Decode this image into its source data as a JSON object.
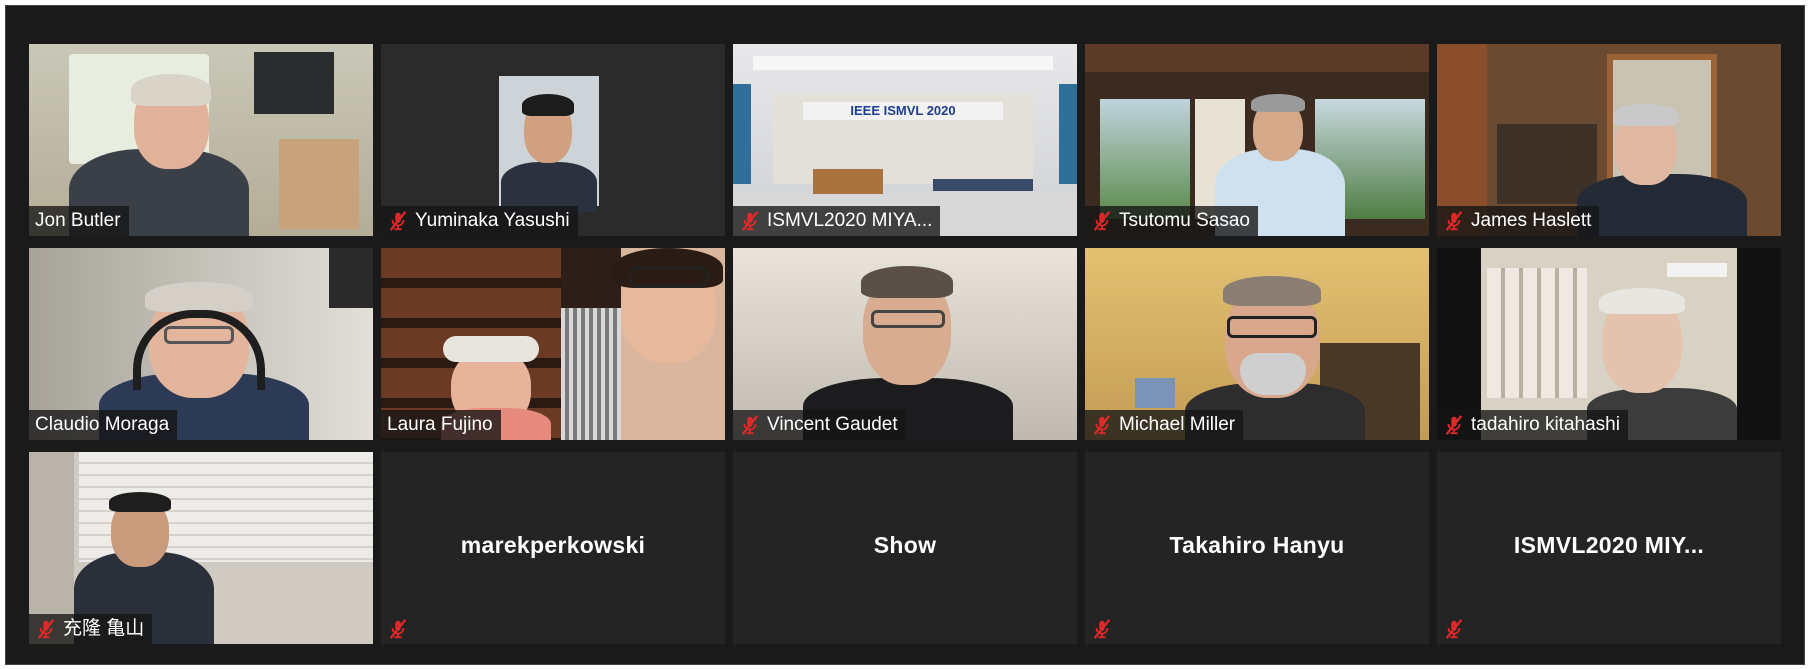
{
  "colors": {
    "background": "#1a1a1a",
    "tile": "#242424",
    "active_speaker_border": "#f3ee7d",
    "muted_icon": "#e02828",
    "label_text": "#ffffff"
  },
  "participants": [
    {
      "name": "Jon Butler",
      "muted": false,
      "video": true,
      "active": true
    },
    {
      "name": "Yuminaka Yasushi",
      "muted": true,
      "video": true
    },
    {
      "name": "ISMVL2020 MIYA...",
      "muted": true,
      "video": true,
      "scene_text": "IEEE ISMVL 2020"
    },
    {
      "name": "Tsutomu Sasao",
      "muted": true,
      "video": true
    },
    {
      "name": "James Haslett",
      "muted": true,
      "video": true
    },
    {
      "name": "Claudio Moraga",
      "muted": false,
      "video": true
    },
    {
      "name": "Laura Fujino",
      "muted": false,
      "video": true
    },
    {
      "name": "Vincent Gaudet",
      "muted": true,
      "video": true
    },
    {
      "name": "Michael Miller",
      "muted": true,
      "video": true
    },
    {
      "name": "tadahiro kitahashi",
      "muted": true,
      "video": true
    },
    {
      "name": "充隆 亀山",
      "muted": true,
      "video": true
    },
    {
      "name": "marekperkowski",
      "muted": true,
      "video": false
    },
    {
      "name": "Show",
      "muted": false,
      "video": false
    },
    {
      "name": "Takahiro Hanyu",
      "muted": true,
      "video": false
    },
    {
      "name": "ISMVL2020 MIY...",
      "muted": true,
      "video": false
    }
  ],
  "icons": {
    "muted": "mic-muted-icon"
  }
}
